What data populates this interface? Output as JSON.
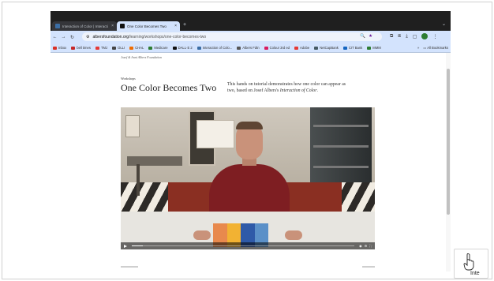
{
  "browser": {
    "tabs": [
      {
        "label": "Interaction of Color | Interacti",
        "favicon_color": "#3b6ea5"
      },
      {
        "label": "One Color Becomes Two",
        "favicon_color": "#111111"
      }
    ],
    "new_tab_icon": "plus-icon",
    "address": {
      "domain": "albersfoundation.org",
      "path": "/learning/workshops/one-color-becomes-two"
    },
    "bookmarks": [
      {
        "label": "Inbox",
        "color": "#d93025"
      },
      {
        "label": "bell times",
        "color": "#c62828"
      },
      {
        "label": "TMJ",
        "color": "#e53935"
      },
      {
        "label": "OLLI",
        "color": "#444444"
      },
      {
        "label": "CHAL",
        "color": "#ef6c00"
      },
      {
        "label": "Medicare",
        "color": "#2e7d32"
      },
      {
        "label": "DALL·E 2",
        "color": "#111111"
      },
      {
        "label": "Interaction of Colo...",
        "color": "#3b6ea5"
      },
      {
        "label": "Albers Fdtn",
        "color": "#555555"
      },
      {
        "label": "Colour 3rd ed",
        "color": "#d81b60"
      },
      {
        "label": "Adobe",
        "color": "#e53935"
      },
      {
        "label": "NetCapBank",
        "color": "#455a64"
      },
      {
        "label": "CIT Bank",
        "color": "#1565c0"
      },
      {
        "label": "MMM",
        "color": "#2e7d32"
      }
    ],
    "bookmarks_more": "»",
    "all_bookmarks": "All Bookmarks"
  },
  "page": {
    "site_name": "Josef & Anni Albers Foundation",
    "eyebrow": "Workshops",
    "title": "One Color Becomes Two",
    "intro_prefix": "This hands on tutorial demonstrates how one color can appear as two, based on Josef Albers's ",
    "intro_book": "Interaction of Color",
    "intro_suffix": ".",
    "video": {
      "progress": 0.05,
      "card_colors": [
        "#e8894d",
        "#f2b233",
        "#2f5aa8",
        "#5b90c8"
      ]
    }
  },
  "corner_widget": {
    "label": "Inte",
    "icon": "hand-pointer-icon"
  }
}
